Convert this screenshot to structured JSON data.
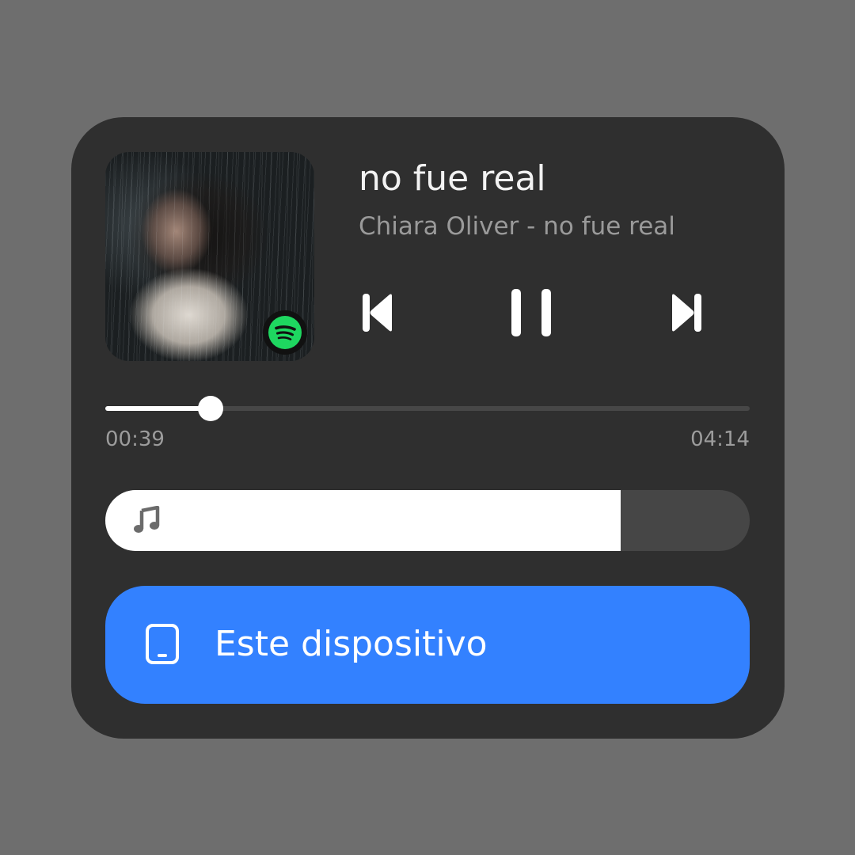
{
  "player": {
    "title": "no fue real",
    "subtitle": "Chiara Oliver - no fue real",
    "current_time": "00:39",
    "total_time": "04:14",
    "progress_fraction": 0.163,
    "volume_fraction": 0.8,
    "source_app_icon": "spotify-icon",
    "device_label": "Este dispositivo",
    "device_icon": "tablet-icon"
  },
  "colors": {
    "background": "#6e6e6e",
    "card": "#2f2f2f",
    "accent": "#3381ff",
    "spotify_green": "#1ed760"
  }
}
